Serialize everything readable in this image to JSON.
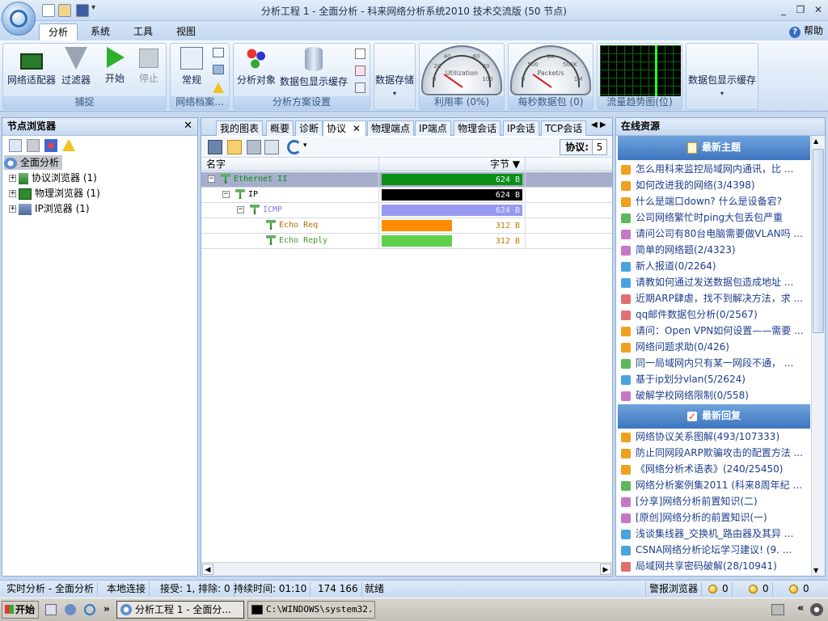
{
  "window": {
    "title": "分析工程 1 - 全面分析 - 科来网络分析系统2010 技术交流版 (50 节点)",
    "minimize": "_",
    "restore": "❐",
    "close": "✕"
  },
  "menu_tabs": [
    {
      "label": "分析"
    },
    {
      "label": "系统"
    },
    {
      "label": "工具"
    },
    {
      "label": "视图"
    }
  ],
  "help_label": "帮助",
  "ribbon": {
    "capture": {
      "label": "捕捉",
      "adapter": "网络适配器",
      "filter": "过滤器",
      "start": "开始",
      "stop": "停止"
    },
    "profile": {
      "label": "网络档案...",
      "normal": "常规"
    },
    "scheme": {
      "label": "分析方案设置",
      "target": "分析对象",
      "packet_cache": "数据包显示缓存"
    },
    "storage": {
      "label": "数据存储"
    },
    "utilization": {
      "label": "利用率 (0%)",
      "gauge_text": "Utilization",
      "ticks": [
        "20",
        "40",
        "60",
        "80",
        "100",
        "0"
      ]
    },
    "pps": {
      "label": "每秒数据包 (0)",
      "gauge_text": "Packet/s",
      "ticks": [
        "500",
        "1K",
        "500K",
        "1M",
        "0"
      ]
    },
    "trend": {
      "label": "流量趋势图(位)"
    },
    "cache": {
      "label": "数据包显示缓存"
    }
  },
  "left_pane": {
    "title": "节点浏览器",
    "close": "✕",
    "tree": [
      {
        "label": "全面分析",
        "selected": true
      },
      {
        "label": "协议浏览器 (1)",
        "exp": "+"
      },
      {
        "label": "物理浏览器 (1)",
        "exp": "+"
      },
      {
        "label": "IP浏览器 (1)",
        "exp": "+"
      }
    ]
  },
  "center": {
    "tabs": [
      {
        "label": "我的图表"
      },
      {
        "label": "概要"
      },
      {
        "label": "诊断"
      },
      {
        "label": "协议",
        "active": true
      },
      {
        "label": "物理端点"
      },
      {
        "label": "IP端点"
      },
      {
        "label": "物理会话"
      },
      {
        "label": "IP会话"
      },
      {
        "label": "TCP会话"
      }
    ],
    "tab_close": "✕",
    "tab_nav": "◀ ▶",
    "protocol_label": "协议:",
    "protocol_count": "5",
    "columns": {
      "name": "名字",
      "bytes": "字节 ▼"
    },
    "rows": [
      {
        "name": "Ethernet II",
        "bytes": "624  B",
        "fill": 1.0,
        "color": "#0a8f14",
        "text_color": "#0a8f14",
        "indent": 0,
        "exp": "−",
        "selected": true
      },
      {
        "name": "IP",
        "bytes": "624  B",
        "fill": 1.0,
        "color": "#000000",
        "text_color": "#000000",
        "indent": 1,
        "exp": "−"
      },
      {
        "name": "ICMP",
        "bytes": "624  B",
        "fill": 1.0,
        "color": "#9898f0",
        "text_color": "#7a7af0",
        "indent": 2,
        "exp": "−"
      },
      {
        "name": "Echo Req",
        "bytes": "312  B",
        "fill": 0.5,
        "color": "#ff8c00",
        "text_color": "#c06a00",
        "indent": 3,
        "exp": ""
      },
      {
        "name": "Echo Reply",
        "bytes": "312  B",
        "fill": 0.5,
        "color": "#5fd04a",
        "text_color": "#3f9a2a",
        "indent": 3,
        "exp": ""
      }
    ]
  },
  "right_pane": {
    "title": "在线资源",
    "latest_topics_title": "最新主题",
    "latest_topics": [
      "怎么用科来监控局域网内通讯，比 ...",
      "如何改进我的网络(3/4398)",
      "什么是端口down? 什么是设备宕?",
      "公司网络繁忙时ping大包丢包严重",
      "请问公司有80台电脑需要做VLAN吗 ...",
      "简单的网络题(2/4323)",
      "新人报道(0/2264)",
      "请教如何通过发送数据包造成地址 ...",
      "近期ARP肆虐，找不到解决方法，求 ...",
      "qq邮件数据包分析(0/2567)",
      "请问：Open VPN如何设置——需要 ...",
      "网络问题求助(0/426)",
      "同一局域网内只有某一网段不通， ...",
      "基于ip划分vlan(5/2624)",
      "破解学校网络限制(0/558)"
    ],
    "latest_replies_title": "最新回复",
    "latest_replies": [
      "网络协议关系图解(493/107333)",
      "防止同网段ARP欺骗攻击的配置方法 ...",
      "《网络分析术语表》(240/25450)",
      "网络分析案例集2011 (科来8周年纪 ...",
      "[分享]网络分析前置知识(二)",
      "[原创]网络分析的前置知识(一)",
      "浅谈集线器_交换机_路由器及其异 ...",
      "CSNA网络分析论坛学习建议! (9. ...",
      "局域网共享密码破解(28/10941)"
    ],
    "badge_colors": [
      "#f0a020",
      "#f0a020",
      "#f0a020",
      "#5cb85c",
      "#c678c6",
      "#c678c6",
      "#4aa3df",
      "#4aa3df",
      "#e07070",
      "#e07070",
      "#f0a020",
      "#f0a020",
      "#5cb85c",
      "#4aa3df",
      "#c678c6"
    ]
  },
  "status": {
    "mode": "实时分析 - 全面分析",
    "conn": "本地连接",
    "recv": "接受: 1, 排除: 0",
    "duration": "持续时间: 01:10",
    "coords": "174  166",
    "ready": "就绪",
    "alarm": "警报浏览器",
    "alarm_counts": [
      "0",
      "0",
      "0"
    ]
  },
  "taskbar": {
    "start": "开始",
    "more": "»",
    "tasks": [
      {
        "label": "分析工程 1 - 全面分...",
        "active": true
      },
      {
        "label": "C:\\WINDOWS\\system32..."
      }
    ],
    "tray_more": "«"
  }
}
